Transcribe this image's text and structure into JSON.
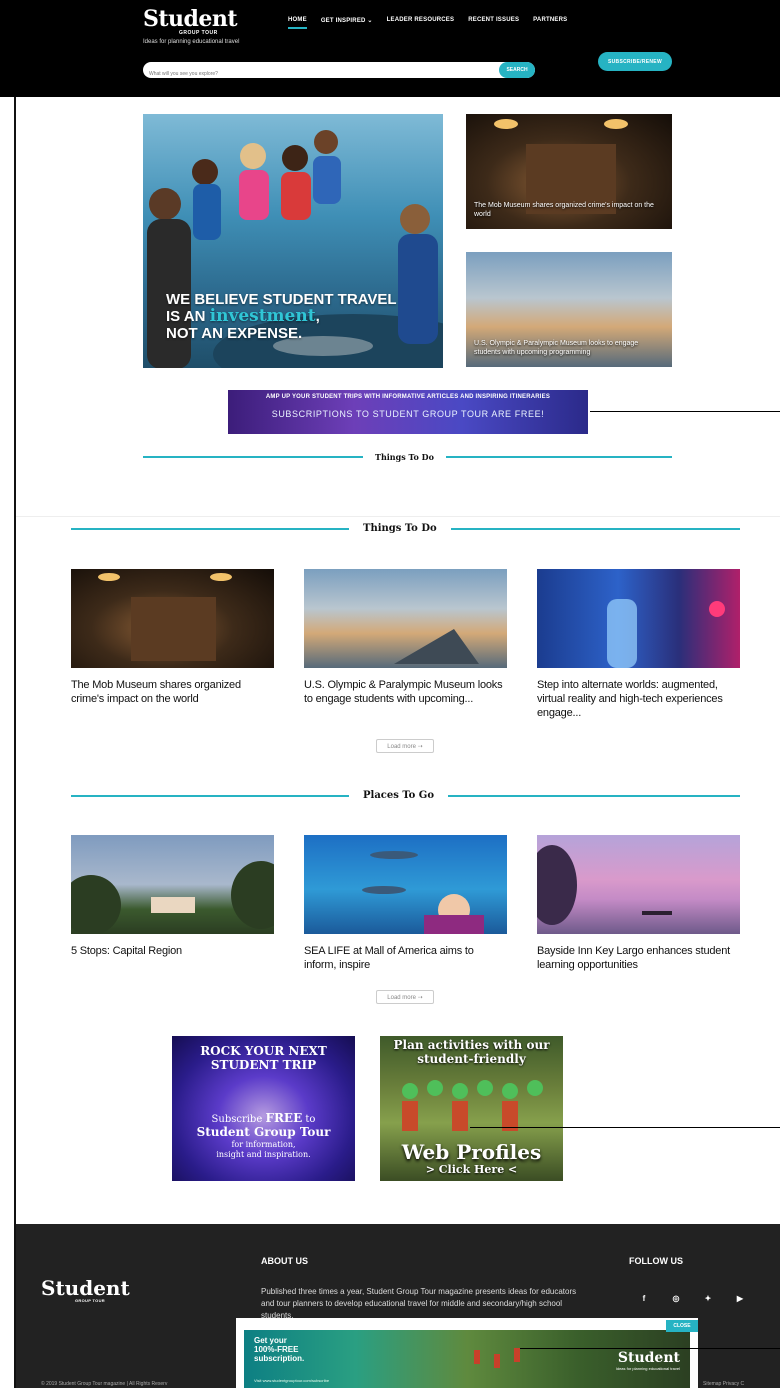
{
  "header": {
    "logo_word": "Student",
    "logo_sub": "GROUP TOUR",
    "tagline": "Ideas for planning educational travel",
    "nav": [
      {
        "label": "HOME"
      },
      {
        "label": "GET INSPIRED ⌄"
      },
      {
        "label": "LEADER RESOURCES"
      },
      {
        "label": "RECENT ISSUES"
      },
      {
        "label": "PARTNERS"
      }
    ],
    "search_placeholder": "What will you see you explore?",
    "search_button": "SEARCH",
    "subscribe_button": "SUBSCRIBE/RENEW"
  },
  "hero": {
    "main_caption_line1": "WE BELIEVE STUDENT TRAVEL",
    "main_caption_line2a": "IS AN ",
    "main_caption_highlight": "investment",
    "main_caption_line2b": ",",
    "main_caption_line3": "NOT AN EXPENSE.",
    "side_cards": [
      {
        "caption": "The Mob Museum shares organized crime's impact on the world"
      },
      {
        "caption": "U.S. Olympic & Paralympic Museum looks to engage students with upcoming programming"
      }
    ]
  },
  "banner": {
    "line1": "AMP UP YOUR STUDENT TRIPS WITH INFORMATIVE ARTICLES AND INSPIRING ITINERARIES",
    "line2": "SUBSCRIPTIONS TO STUDENT GROUP TOUR ARE FREE!"
  },
  "sections": {
    "things_small": "Things To Do",
    "things": "Things To Do",
    "places": "Places To Go",
    "load_more": "Load more ⇢"
  },
  "things_to_do": [
    {
      "title": "The Mob Museum shares organized crime's impact on the world"
    },
    {
      "title": "U.S. Olympic & Paralympic Museum looks to engage students with upcoming..."
    },
    {
      "title": "Step into alternate worlds: augmented, virtual reality and high-tech experiences engage..."
    }
  ],
  "places_to_go": [
    {
      "title": "5 Stops: Capital Region"
    },
    {
      "title": "SEA LIFE at Mall of America aims to inform, inspire"
    },
    {
      "title": "Bayside Inn Key Largo enhances student learning opportunities"
    }
  ],
  "ads": {
    "ad1_line1": "ROCK YOUR NEXT",
    "ad1_line2": "STUDENT TRIP",
    "ad1_sub_a": "Subscribe ",
    "ad1_sub_free": "FREE",
    "ad1_sub_b": " to",
    "ad1_sub_c": "Student Group Tour",
    "ad1_small1": "for information,",
    "ad1_small2": "insight and inspiration.",
    "ad2_line1": "Plan activities with our",
    "ad2_line2": "student-friendly",
    "ad2_big": "Web Profiles",
    "ad2_click": "> Click Here <"
  },
  "footer": {
    "logo_word": "Student",
    "logo_sub": "GROUP TOUR",
    "about_heading": "ABOUT US",
    "about_text": "Published three times a year, Student Group Tour magazine presents ideas for educators and tour planners to develop educational travel for middle and secondary/high school students.",
    "follow_heading": "FOLLOW US",
    "socials": [
      {
        "icon": "facebook-icon",
        "glyph": "f"
      },
      {
        "icon": "instagram-icon",
        "glyph": "◎"
      },
      {
        "icon": "twitter-icon",
        "glyph": "✦"
      },
      {
        "icon": "youtube-icon",
        "glyph": "▶"
      }
    ],
    "copyright": "© 2019 Student Group Tour magazine | All Rights Reserv",
    "links": "Sitemap   Privacy   C"
  },
  "popup": {
    "line1": "Get your",
    "line2": "100%-FREE",
    "line3": "subscription.",
    "url": "Visit www.studentgrouptour.com/subscribe",
    "logo": "Student",
    "logo_sub": "Ideas for planning educational travel",
    "close": "CLOSE"
  },
  "colors": {
    "accent": "#26b3c3",
    "header_bg": "#000000",
    "footer_bg": "#222222"
  }
}
